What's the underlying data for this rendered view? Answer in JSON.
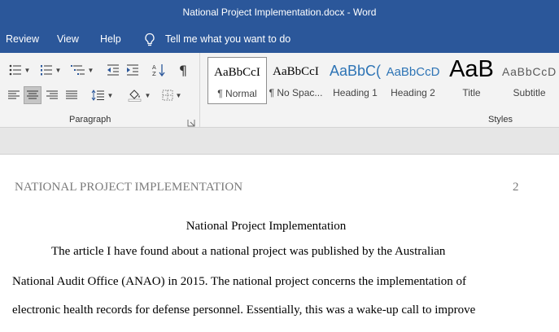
{
  "window": {
    "title": "National Project Implementation.docx  -  Word"
  },
  "menu": {
    "items": [
      "Review",
      "View",
      "Help"
    ],
    "tell_me": "Tell me what you want to do"
  },
  "ribbon": {
    "paragraph": {
      "label": "Paragraph"
    },
    "styles": {
      "label": "Styles",
      "items": [
        {
          "sample": "AaBbCcI",
          "name": "¶ Normal"
        },
        {
          "sample": "AaBbCcI",
          "name": "¶ No Spac..."
        },
        {
          "sample": "AaBbC(",
          "name": "Heading 1"
        },
        {
          "sample": "AaBbCcD",
          "name": "Heading 2"
        },
        {
          "sample": "AaB",
          "name": "Title"
        },
        {
          "sample": "AaBbCcD",
          "name": "Subtitle"
        }
      ]
    }
  },
  "document": {
    "header": "NATIONAL PROJECT IMPLEMENTATION",
    "page_number": "2",
    "title": "National Project Implementation",
    "lines": [
      "The article I have found about a national project was published by the Australian",
      "National Audit Office (ANAO) in 2015. The national project concerns the implementation of",
      "electronic health records for defense personnel. Essentially, this was a wake-up call to improve"
    ]
  },
  "colors": {
    "accent": "#2b579a",
    "heading_blue": "#2e74b5",
    "ribbon_bg": "#f3f3f3"
  }
}
